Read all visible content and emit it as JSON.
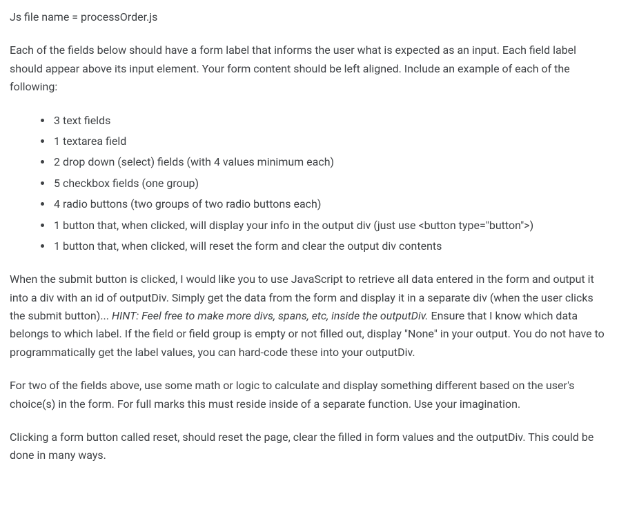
{
  "heading": "Js file name = processOrder.js",
  "intro": "Each of the fields below should have a form label that informs the user what is expected as an input. Each field label should appear above its input element. Your form content should be left aligned. Include an example of each of the following:",
  "requirements": [
    "3 text fields",
    "1 textarea field",
    "2 drop down (select) fields (with 4 values minimum each)",
    "5 checkbox fields (one group)",
    "4 radio buttons (two groups of two radio buttons each)",
    "1 button that, when clicked, will display your info in the output div (just use <button type=\"button\">)",
    "1 button that, when clicked, will reset the form and clear the output div contents"
  ],
  "para_submit_a": "When the submit button is clicked, I would like you to use JavaScript to retrieve all data entered in the form and output it into a div with an id of outputDiv. Simply get the data from the form and display it in a separate div (when the user clicks the submit button)... ",
  "para_submit_hint": "HINT: Feel free to make more divs, spans, etc, inside the outputDiv.",
  "para_submit_b": " Ensure that I know which data belongs to which label. If the field or field group is empty or not filled out, display \"None\" in your output. You do not have to programmatically get the label values, you can hard-code these into your outputDiv.",
  "para_logic": "For two of the fields above, use some math or logic to calculate and display something different based on the user's choice(s) in the form. For full marks this must reside inside of a separate function. Use your imagination.",
  "para_reset": "Clicking a form button called reset, should reset the page, clear the filled in form values and the outputDiv. This could be done in many ways."
}
